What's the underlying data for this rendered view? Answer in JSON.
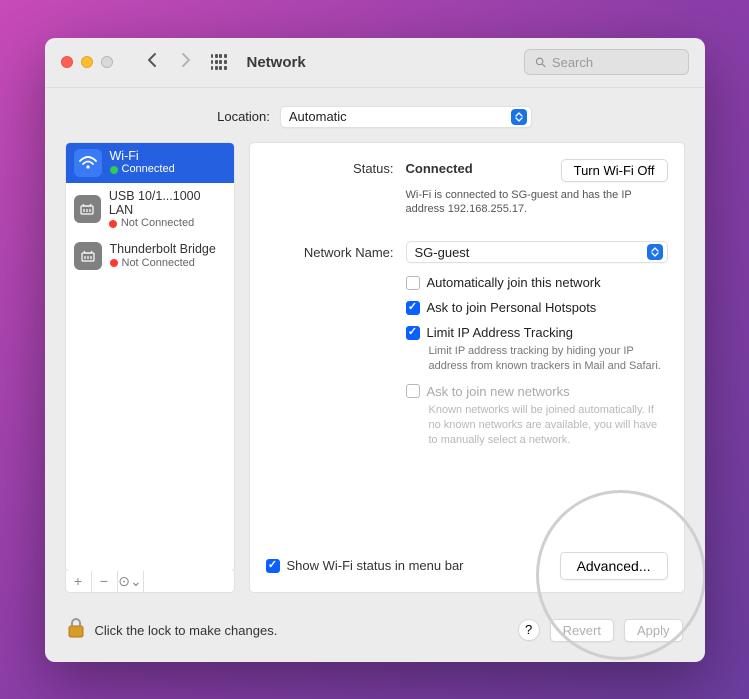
{
  "window": {
    "title": "Network",
    "search_placeholder": "Search"
  },
  "location": {
    "label": "Location:",
    "value": "Automatic"
  },
  "interfaces": [
    {
      "name": "Wi-Fi",
      "status_text": "Connected",
      "status_color": "green",
      "selected": true,
      "icon": "wifi"
    },
    {
      "name": "USB 10/1...1000 LAN",
      "status_text": "Not Connected",
      "status_color": "red",
      "selected": false,
      "icon": "ethernet"
    },
    {
      "name": "Thunderbolt Bridge",
      "status_text": "Not Connected",
      "status_color": "red",
      "selected": false,
      "icon": "thunderbolt"
    }
  ],
  "sidebar_buttons": {
    "add": "+",
    "remove": "−",
    "action": "⊙⌄"
  },
  "details": {
    "status_label": "Status:",
    "status_value": "Connected",
    "turn_off_btn": "Turn Wi-Fi Off",
    "status_desc": "Wi-Fi is connected to SG-guest and has the IP address 192.168.255.17.",
    "network_label": "Network Name:",
    "network_value": "SG-guest",
    "checks": {
      "auto_join": {
        "label": "Automatically join this network",
        "checked": false
      },
      "ask_hotspot": {
        "label": "Ask to join Personal Hotspots",
        "checked": true
      },
      "limit_ip": {
        "label": "Limit IP Address Tracking",
        "checked": true,
        "desc": "Limit IP address tracking by hiding your IP address from known trackers in Mail and Safari."
      },
      "ask_new": {
        "label": "Ask to join new networks",
        "checked": false,
        "disabled": true,
        "desc": "Known networks will be joined automatically. If no known networks are available, you will have to manually select a network."
      }
    },
    "show_menubar": {
      "label": "Show Wi-Fi status in menu bar",
      "checked": true
    },
    "advanced_btn": "Advanced..."
  },
  "footer": {
    "lock_hint": "Click the lock to make changes.",
    "help": "?",
    "revert": "Revert",
    "apply": "Apply"
  }
}
